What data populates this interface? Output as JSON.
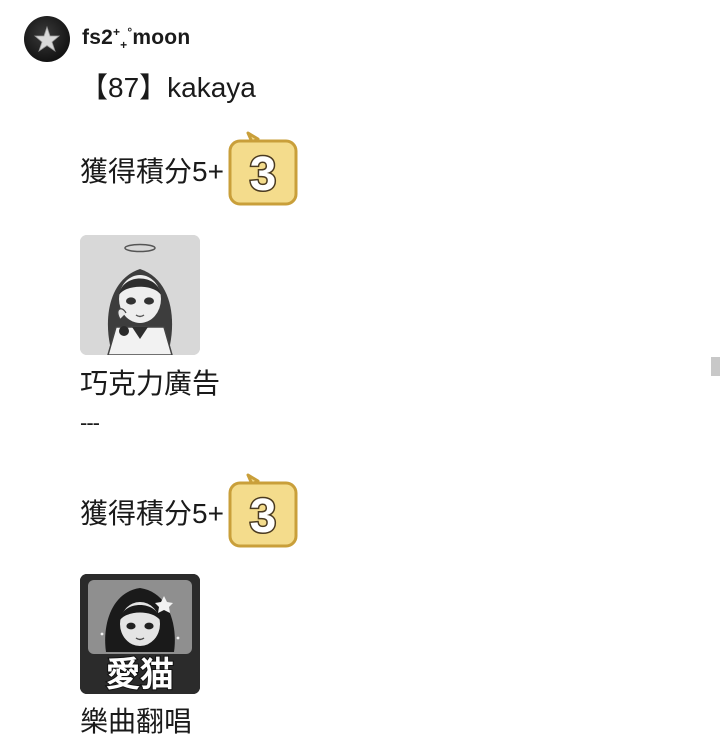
{
  "author": {
    "avatar_icon": "star-icon",
    "name_main": "fs2",
    "name_sup": "+",
    "name_sub": "+",
    "name_deg": "°",
    "name_tail": "moon"
  },
  "message": {
    "line1": "【87】kakaya",
    "entries": [
      {
        "points_text": "獲得積分5+",
        "badge_number": "3",
        "badge_icon": "number-3-sticker-icon",
        "caption": "巧克力廣告"
      },
      {
        "points_text": "獲得積分5+",
        "badge_number": "3",
        "badge_icon": "number-3-sticker-icon",
        "caption": "樂曲翻唱",
        "thumbnail_text": "愛猫"
      }
    ],
    "divider": "---"
  },
  "colors": {
    "badge_fill": "#F4DC8C",
    "badge_stroke": "#C99F3A",
    "text": "#1A1A1A"
  }
}
